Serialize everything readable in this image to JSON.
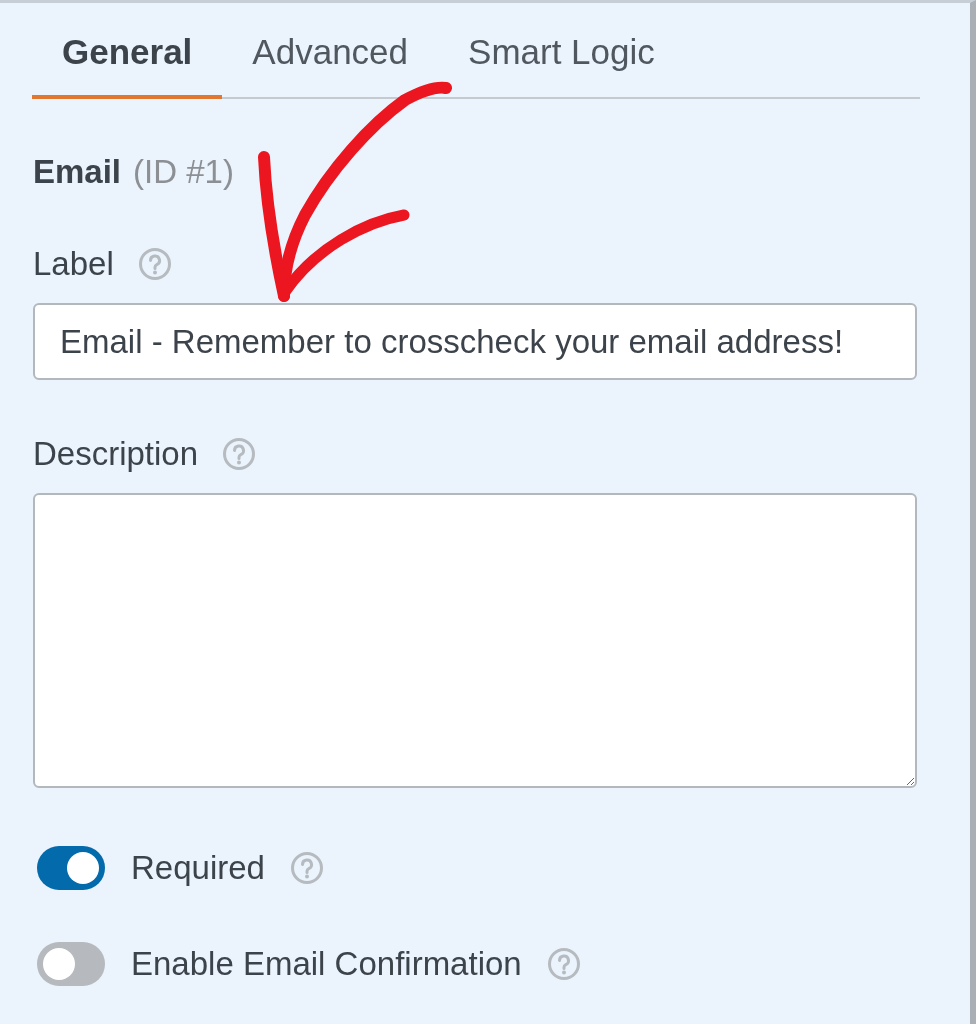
{
  "tabs": [
    {
      "label": "General",
      "selected": true
    },
    {
      "label": "Advanced",
      "selected": false
    },
    {
      "label": "Smart Logic",
      "selected": false
    }
  ],
  "field_heading": {
    "name": "Email",
    "id_text": "(ID #1)"
  },
  "fields": [
    {
      "kind": "input",
      "label": "Label",
      "help": true,
      "value": "Email - Remember to crosscheck your email address!"
    },
    {
      "kind": "textarea",
      "label": "Description",
      "help": true
    }
  ],
  "toggles": [
    {
      "label": "Required",
      "on": true,
      "help": true
    },
    {
      "label": "Enable Email Confirmation",
      "on": false,
      "help": true
    }
  ],
  "annotations": [
    {
      "kind": "arrow"
    }
  ]
}
